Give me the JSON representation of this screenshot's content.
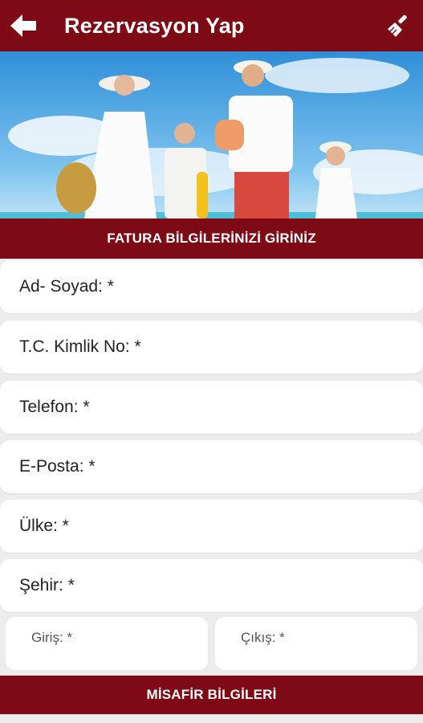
{
  "appbar": {
    "title": "Rezervasyon Yap",
    "back_icon": "arrow-left-icon",
    "clear_icon": "broom-icon"
  },
  "hero": {
    "description_icon": "family-beach-photo"
  },
  "billing_section": {
    "title": "FATURA BİLGİLERİNİZİ GİRİNİZ"
  },
  "fields": {
    "name": "Ad- Soyad: *",
    "tc": "T.C. Kimlik No: *",
    "phone": "Telefon: *",
    "email": "E-Posta: *",
    "country": "Ülke: *",
    "city": "Şehir: *",
    "checkin": "Giriş: *",
    "checkout": "Çıkış: *"
  },
  "guest_section": {
    "title": "MİSAFİR BİLGİLERİ"
  },
  "colors": {
    "brand": "#7d0a14",
    "background": "#ececec"
  }
}
